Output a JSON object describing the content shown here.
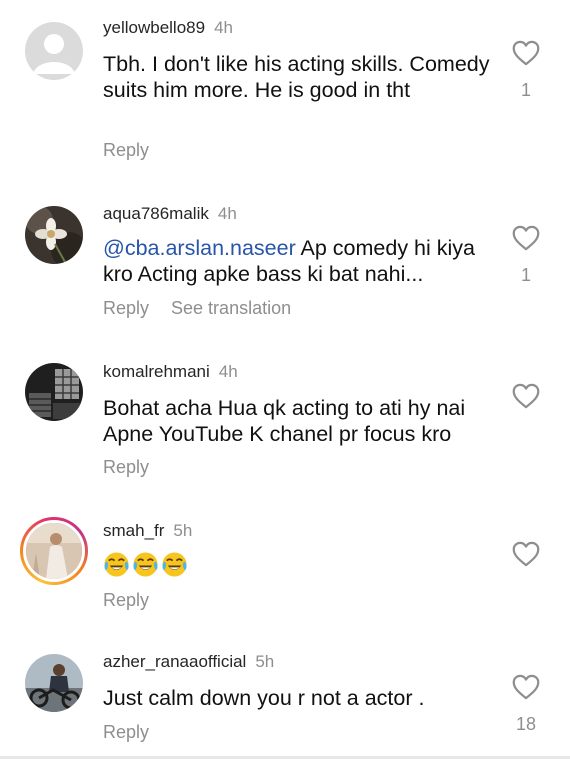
{
  "comments": [
    {
      "username": "yellowbello89",
      "time": "4h",
      "text": "Tbh. I don't like his acting skills. Comedy suits him more. He is good in tht",
      "mention": "",
      "reply_label": "Reply",
      "see_translation": "",
      "like_count": "1",
      "avatar": "default-avatar-icon"
    },
    {
      "username": "aqua786malik",
      "time": "4h",
      "mention": "@cba.arslan.naseer",
      "text": " Ap comedy hi kiya kro Acting apke bass ki bat nahi...",
      "reply_label": "Reply",
      "see_translation": "See translation",
      "like_count": "1",
      "avatar": "flower-photo-avatar"
    },
    {
      "username": "komalrehmani",
      "time": "4h",
      "text": "Bohat acha Hua qk acting to ati hy nai Apne YouTube K chanel pr focus kro",
      "mention": "",
      "reply_label": "Reply",
      "see_translation": "",
      "like_count": "",
      "avatar": "room-photo-avatar"
    },
    {
      "username": "smah_fr",
      "time": "5h",
      "text": "",
      "mention": "",
      "emojis": [
        "face-with-tears-of-joy",
        "face-with-tears-of-joy",
        "face-with-tears-of-joy"
      ],
      "reply_label": "Reply",
      "see_translation": "",
      "like_count": "",
      "avatar": "story-ring-avatar"
    },
    {
      "username": "azher_ranaaofficial",
      "time": "5h",
      "text": "Just calm down you r not a actor .",
      "mention": "",
      "reply_label": "Reply",
      "see_translation": "",
      "like_count": "18",
      "avatar": "motorbike-photo-avatar"
    }
  ],
  "colors": {
    "username": "#262626",
    "muted": "#8e8e8e",
    "mention": "#2855a8",
    "text": "#111111"
  }
}
